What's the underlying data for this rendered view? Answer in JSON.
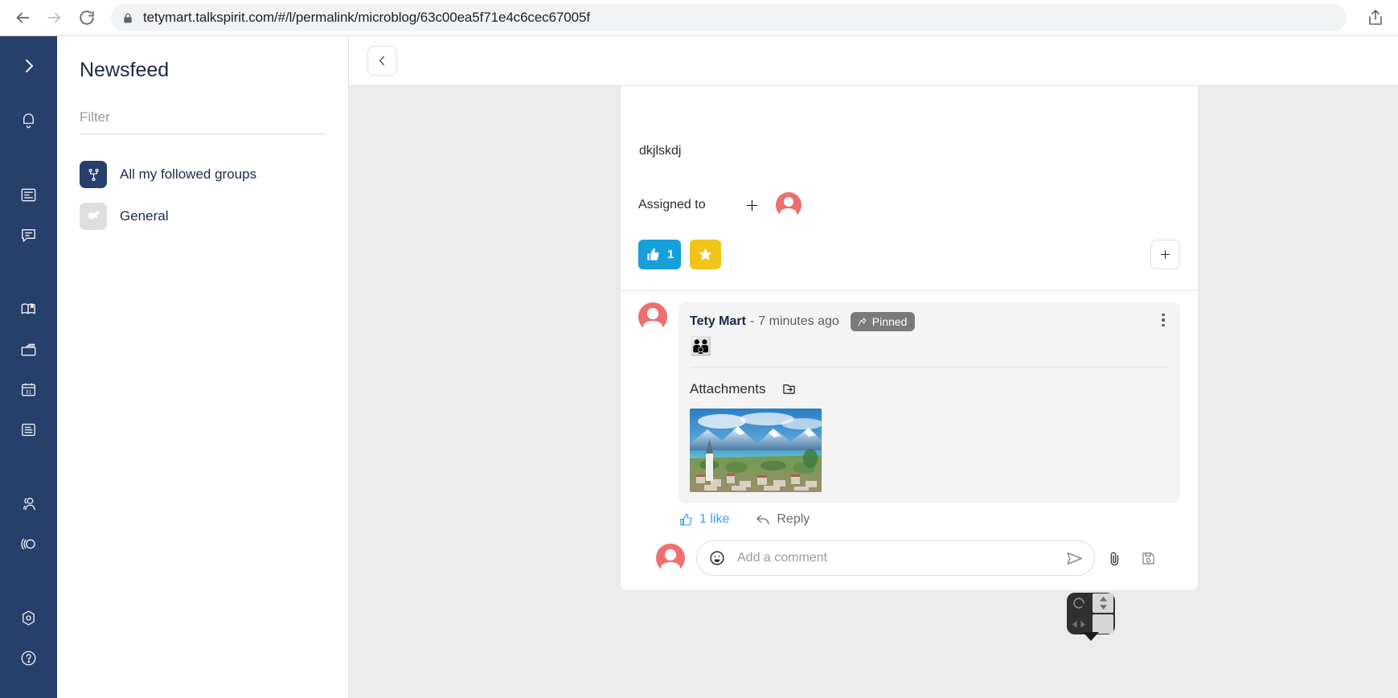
{
  "browser": {
    "url": "tetymart.talkspirit.com/#/l/permalink/microblog/63c00ea5f71e4c6cec67005f",
    "back_icon": "arrow-left-icon",
    "forward_icon": "arrow-right-icon",
    "reload_icon": "reload-icon",
    "lock_icon": "lock-icon",
    "share_icon": "share-icon"
  },
  "rail": {
    "expand_icon": "chevron-right-icon",
    "items": [
      {
        "icon": "bell-icon",
        "name": "notifications"
      },
      {
        "icon": "newsfeed-icon",
        "name": "newsfeed"
      },
      {
        "icon": "chat-icon",
        "name": "chat"
      },
      {
        "icon": "book-icon",
        "name": "wiki"
      },
      {
        "icon": "folder-icon",
        "name": "drive"
      },
      {
        "icon": "calendar-icon",
        "name": "calendar"
      },
      {
        "icon": "tasks-icon",
        "name": "tasks"
      },
      {
        "icon": "people-icon",
        "name": "directory"
      },
      {
        "icon": "broadcast-icon",
        "name": "broadcast"
      },
      {
        "icon": "settings-icon",
        "name": "settings"
      },
      {
        "icon": "help-icon",
        "name": "help"
      }
    ]
  },
  "sidebar": {
    "title": "Newsfeed",
    "filter_placeholder": "Filter",
    "filter_value": "",
    "groups": [
      {
        "label": "All my followed groups",
        "icon": "network-icon",
        "style": "navy"
      },
      {
        "label": "General",
        "icon": "megaphone-icon",
        "style": "grey"
      }
    ]
  },
  "main": {
    "back_button_icon": "chevron-left-icon"
  },
  "post": {
    "text": "dkjlskdj",
    "assigned_label": "Assigned to",
    "assigned_add_icon": "plus-icon",
    "assignee_avatar": "user-avatar",
    "reactions": [
      {
        "emoji": "thumbs-up",
        "count": "1",
        "color": "#169fdb"
      },
      {
        "emoji": "star",
        "count": "",
        "color": "#f0c419"
      }
    ],
    "add_reaction_icon": "plus-icon"
  },
  "comment": {
    "author": "Tety Mart",
    "separator": "-",
    "timestamp": "7 minutes ago",
    "pinned_label": "Pinned",
    "pinned_icon": "pin-icon",
    "menu_icon": "kebab-menu-icon",
    "body_emoji": "👪",
    "attachments_label": "Attachments",
    "attachments_icon": "open-folder-arrow-icon",
    "attachment_alt": "lake-and-mountains-photo",
    "like_label": "1 like",
    "like_icon": "thumbs-up-icon",
    "reply_label": "Reply",
    "reply_icon": "reply-arrow-icon"
  },
  "composer": {
    "avatar": "user-avatar",
    "emoji_icon": "smiley-icon",
    "placeholder": "Add a comment",
    "value": "",
    "send_icon": "send-icon",
    "attach_icon": "paperclip-icon",
    "drive_icon": "save-drive-icon"
  },
  "cursor_widget": {
    "rotate_icon": "rotate-icon",
    "vertical_icon": "up-down-arrows-icon",
    "horizontal_icon": "left-right-arrows-icon"
  },
  "colors": {
    "brand_navy": "#27406b",
    "like_blue": "#169fdb",
    "star_yellow": "#f0c419",
    "avatar_red": "#ee6f6f",
    "canvas_grey": "#ececec"
  }
}
